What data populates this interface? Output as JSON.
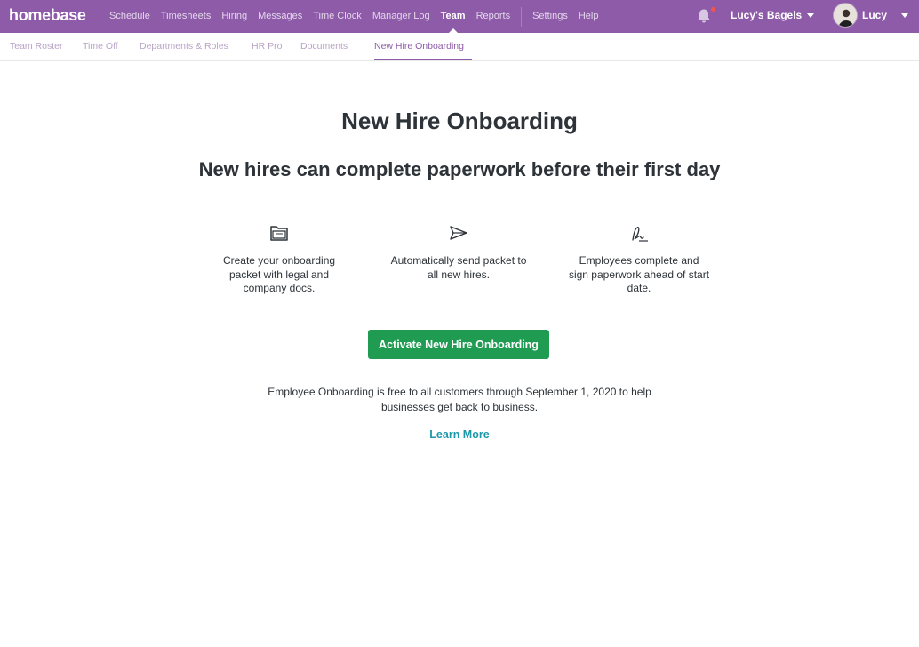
{
  "app": {
    "logo": "homebase"
  },
  "topnav": {
    "items": [
      {
        "label": "Schedule"
      },
      {
        "label": "Timesheets"
      },
      {
        "label": "Hiring"
      },
      {
        "label": "Messages"
      },
      {
        "label": "Time Clock"
      },
      {
        "label": "Manager Log"
      },
      {
        "label": "Team"
      },
      {
        "label": "Reports"
      },
      {
        "label": "Settings"
      },
      {
        "label": "Help"
      }
    ],
    "active": "Team",
    "org_name": "Lucy's Bagels",
    "user_name": "Lucy",
    "notification_icon": "bell-icon"
  },
  "subnav": {
    "items": [
      {
        "label": "Team Roster"
      },
      {
        "label": "Time Off"
      },
      {
        "label": "Departments & Roles"
      },
      {
        "label": "HR Pro"
      },
      {
        "label": "Documents"
      },
      {
        "label": "New Hire Onboarding"
      }
    ],
    "active": "New Hire Onboarding"
  },
  "main": {
    "title": "New Hire Onboarding",
    "subtitle": "New hires can complete paperwork before their first day",
    "features": [
      {
        "icon": "folder-icon",
        "text": "Create your onboarding packet with legal and company docs."
      },
      {
        "icon": "paper-plane-icon",
        "text": "Automatically send packet to all new hires."
      },
      {
        "icon": "signature-icon",
        "text": "Employees complete and sign paperwork ahead of start date."
      }
    ],
    "cta_label": "Activate New Hire Onboarding",
    "note_line1": "Employee Onboarding is free to all customers through September 1, 2020 to help",
    "note_line2": "businesses get back to business.",
    "learn_more": "Learn More"
  },
  "colors": {
    "brand_purple": "#8d5ba8",
    "cta_green": "#1f9b52",
    "link_teal": "#1c98a8",
    "notification_red": "#f0544f"
  }
}
